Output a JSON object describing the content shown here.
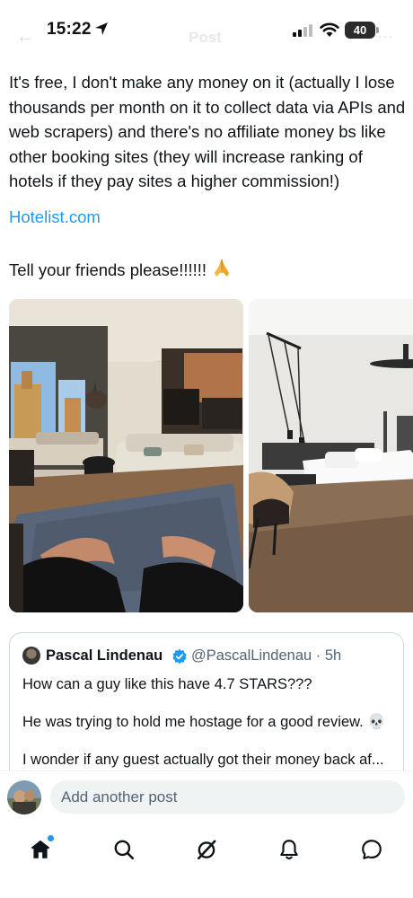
{
  "status_bar": {
    "time": "15:22",
    "battery": "40"
  },
  "header": {
    "title": "Post"
  },
  "post": {
    "text": "It's free, I don't make any money on it (actually I lose thousands per month on it to collect data via APIs and web scrapers) and there's no affiliate money bs like other booking sites (they will increase ranking of hotels if they pay sites a higher commission!)",
    "link": "Hotelist.com",
    "cta": "Tell your friends please!!!!!!"
  },
  "quote": {
    "name": "Pascal Lindenau",
    "handle": "@PascalLindenau · 5h",
    "line1": "How can a guy like this have 4.7 STARS???",
    "line2": "He was trying to hold me hostage for a good review. 💀",
    "line3": "I wonder if any guest actually got their money back af..."
  },
  "reply": {
    "placeholder": "Add another post"
  },
  "tabs": [
    "home",
    "search",
    "grok",
    "notifications",
    "messages"
  ],
  "colors": {
    "accent": "#1d9bf0",
    "text": "#0f1419",
    "muted": "#536471"
  }
}
